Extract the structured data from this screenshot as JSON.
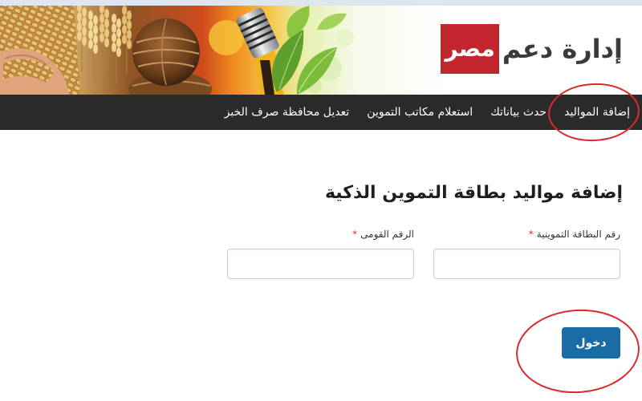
{
  "header": {
    "logo": {
      "text": "إدارة دعم",
      "boxed_text": "مصر"
    }
  },
  "nav": {
    "items": [
      {
        "label": "إضافة المواليد"
      },
      {
        "label": "حدث بياناتك"
      },
      {
        "label": "استعلام مكاتب التموين"
      },
      {
        "label": "تعديل محافظة صرف الخبز"
      }
    ]
  },
  "form": {
    "title": "إضافة مواليد بطاقة التموين الذكية",
    "fields": [
      {
        "label": "رقم البطاقة التموينية",
        "required_mark": "*",
        "value": ""
      },
      {
        "label": "الرقم القومى",
        "required_mark": "*",
        "value": ""
      }
    ],
    "submit_label": "دخول"
  },
  "colors": {
    "logo_box": "#c1272d",
    "nav_background": "#2b2b2b",
    "button": "#1b6ba4",
    "required_mark": "#d8322b",
    "highlight_ring": "#d92a2d"
  }
}
